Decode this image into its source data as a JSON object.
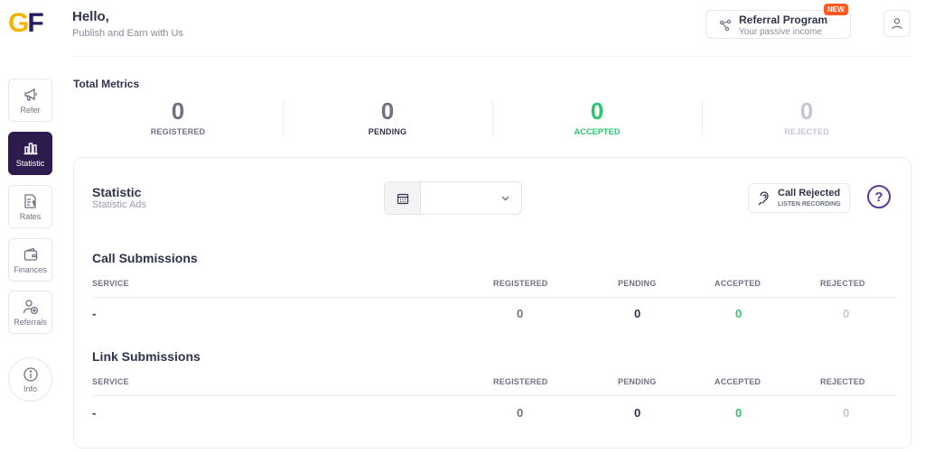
{
  "brand": {
    "logo_g": "G",
    "logo_f": "F"
  },
  "header": {
    "greeting": "Hello,",
    "subtitle": "Publish and Earn with Us",
    "referral_title": "Referral Program",
    "referral_sub": "Your passive income",
    "referral_badge": "NEW",
    "user_icon": "user-icon"
  },
  "sidebar": {
    "items": [
      {
        "label": "Refer",
        "icon": "megaphone-icon"
      },
      {
        "label": "Statistic",
        "icon": "bar-chart-icon",
        "active": true
      },
      {
        "label": "Rates",
        "icon": "rates-icon"
      },
      {
        "label": "Finances",
        "icon": "wallet-icon"
      },
      {
        "label": "Referrals",
        "icon": "user-plus-icon"
      },
      {
        "label": "Info",
        "icon": "info-icon"
      }
    ]
  },
  "metrics": {
    "title": "Total Metrics",
    "items": [
      {
        "value": "0",
        "label": "REGISTERED"
      },
      {
        "value": "0",
        "label": "PENDING"
      },
      {
        "value": "0",
        "label": "ACCEPTED"
      },
      {
        "value": "0",
        "label": "REJECTED"
      }
    ]
  },
  "statistic": {
    "title": "Statistic",
    "subtitle": "Statistic Ads",
    "date_value": "",
    "call_rejected_title": "Call Rejected",
    "call_rejected_sub": "LISTEN RECORDING",
    "help": "?"
  },
  "tables": [
    {
      "title": "Call Submissions",
      "headers": [
        "SERVICE",
        "REGISTERED",
        "PENDING",
        "ACCEPTED",
        "REJECTED"
      ],
      "row": [
        "-",
        "0",
        "0",
        "0",
        "0"
      ]
    },
    {
      "title": "Link Submissions",
      "headers": [
        "SERVICE",
        "REGISTERED",
        "PENDING",
        "ACCEPTED",
        "REJECTED"
      ],
      "row": [
        "-",
        "0",
        "0",
        "0",
        "0"
      ]
    }
  ],
  "colors": {
    "brand_dark": "#2d1b4e",
    "accent_yellow": "#f4b400",
    "accepted": "#28c76f",
    "rejected": "#c4c7d1",
    "badge": "#ff5b1f"
  }
}
